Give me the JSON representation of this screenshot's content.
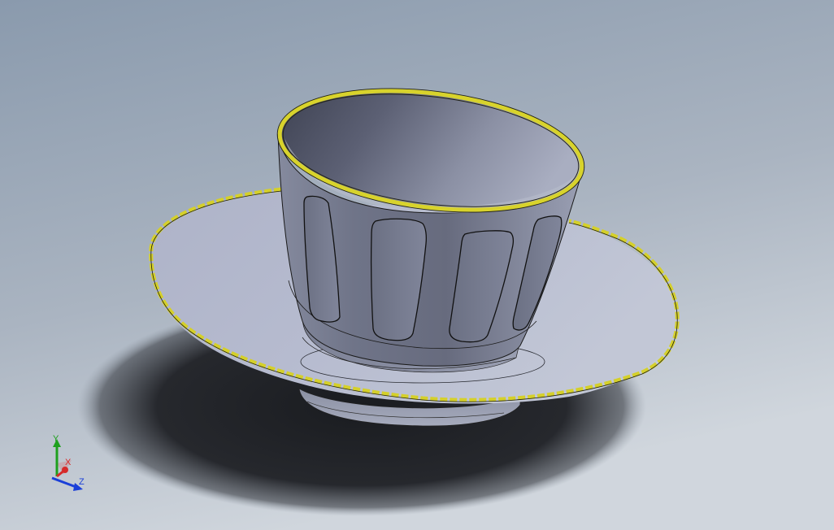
{
  "viewport": {
    "background_top": "#8c9cae",
    "background_bottom": "#d2d8df",
    "shadow_color": "#1c1e22",
    "model_face_color": "#9ea3b8",
    "model_dark_color": "#4e5264",
    "edge_highlight_color": "#d6d12a",
    "edge_line_color": "#000000"
  },
  "model": {
    "name": "cup-and-saucer",
    "cup_panel_count": 4,
    "saucer_rim_segments": 44
  },
  "triad": {
    "x_label": "X",
    "y_label": "Y",
    "z_label": "Z",
    "x_color": "#d62a2a",
    "y_color": "#1ea01e",
    "z_color": "#1a3fd8"
  }
}
